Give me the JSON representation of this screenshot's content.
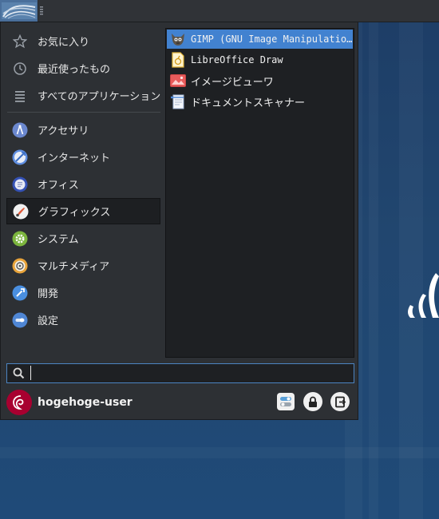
{
  "panel": {
    "menu_button_icon": "xfce-whisker-icon",
    "handle_icon": "drag-handle-icon"
  },
  "categories": [
    {
      "label": "お気に入り",
      "icon": "star-icon"
    },
    {
      "label": "最近使ったもの",
      "icon": "clock-icon"
    },
    {
      "label": "すべてのアプリケーション",
      "icon": "list-icon"
    },
    {
      "label": "アクセサリ",
      "icon": "accessories-icon"
    },
    {
      "label": "インターネット",
      "icon": "globe-icon"
    },
    {
      "label": "オフィス",
      "icon": "office-icon"
    },
    {
      "label": "グラフィックス",
      "icon": "graphics-icon",
      "selected": true
    },
    {
      "label": "システム",
      "icon": "system-gear-icon"
    },
    {
      "label": "マルチメディア",
      "icon": "multimedia-icon"
    },
    {
      "label": "開発",
      "icon": "development-icon"
    },
    {
      "label": "設定",
      "icon": "settings-icon"
    }
  ],
  "apps": [
    {
      "label": "GIMP (GNU Image Manipulation Program)",
      "icon": "gimp-icon",
      "highlighted": true
    },
    {
      "label": "LibreOffice Draw",
      "icon": "libreoffice-draw-icon"
    },
    {
      "label": "イメージビューワ",
      "icon": "image-viewer-icon"
    },
    {
      "label": "ドキュメントスキャナー",
      "icon": "document-scanner-icon"
    }
  ],
  "search": {
    "value": "",
    "placeholder": "",
    "icon": "search-icon"
  },
  "user": {
    "name": "hogehoge-user",
    "avatar_icon": "debian-swirl-icon"
  },
  "actions": [
    {
      "name": "settings-manager-button",
      "icon": "settings-manager-icon"
    },
    {
      "name": "lock-screen-button",
      "icon": "lock-icon"
    },
    {
      "name": "logout-button",
      "icon": "logout-icon"
    }
  ],
  "colors": {
    "accent": "#4282d0",
    "avatar": "#a80030",
    "panel": "#303337",
    "desktop": "#21466f"
  }
}
